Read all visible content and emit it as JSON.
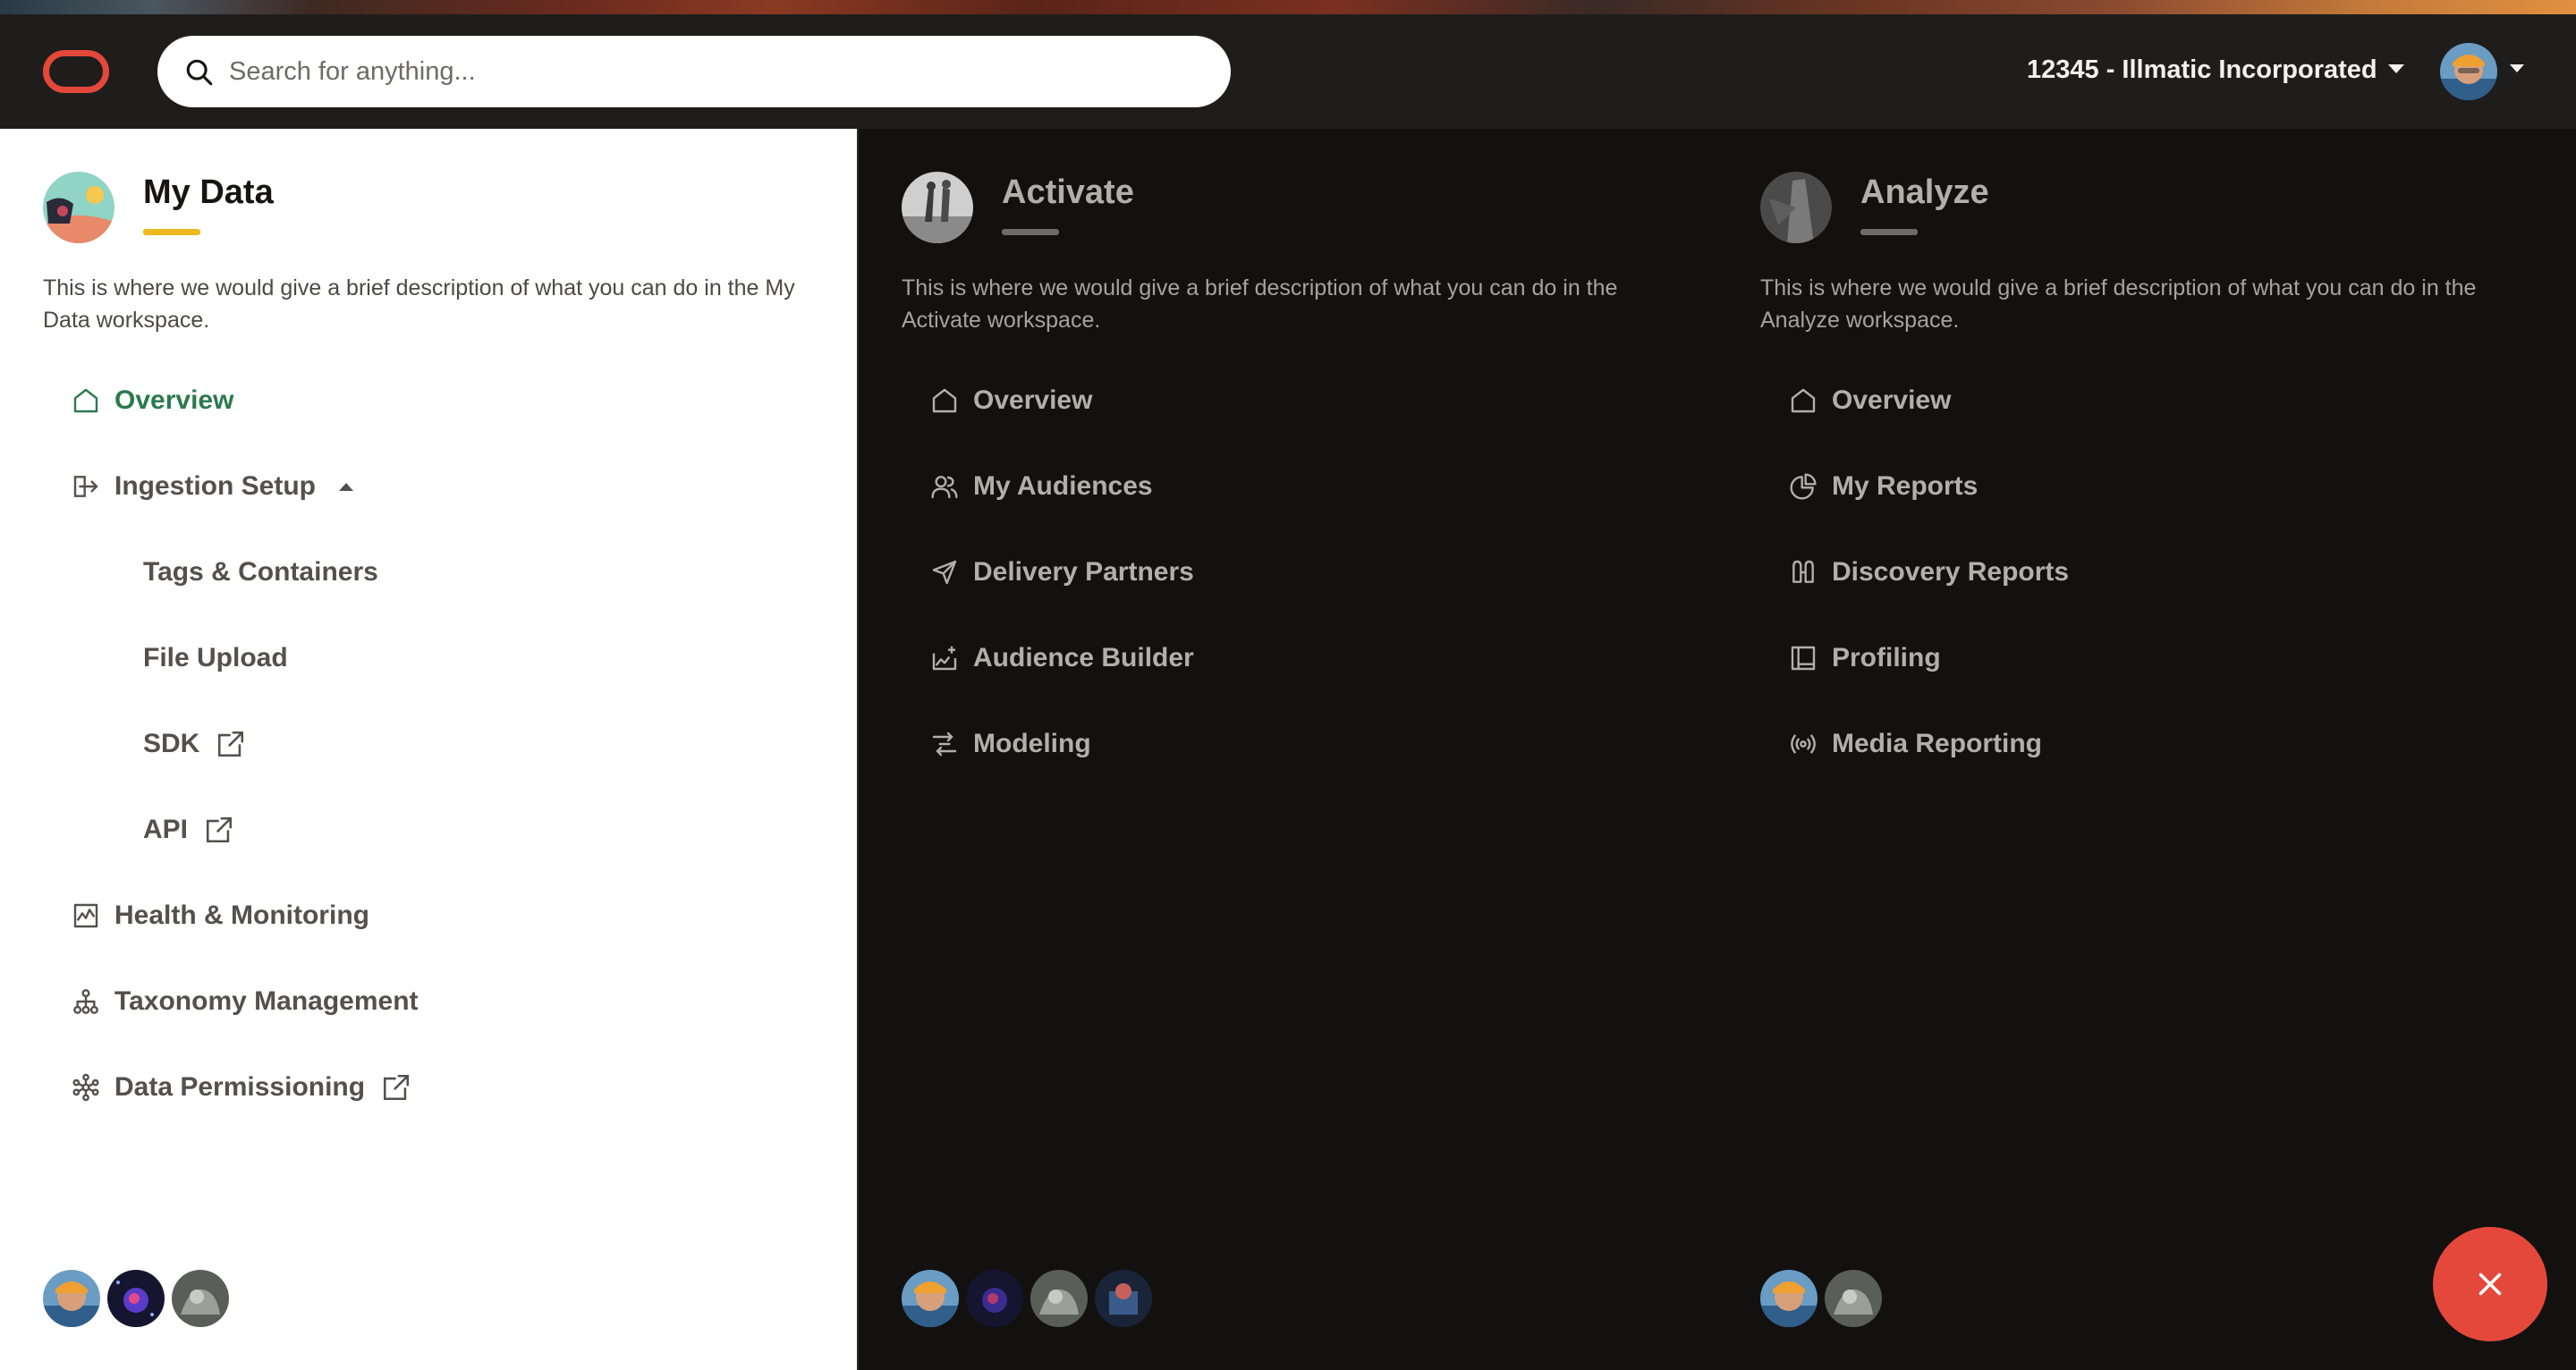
{
  "header": {
    "search_placeholder": "Search for anything...",
    "org_name": "12345 - Illmatic Incorporated"
  },
  "colors": {
    "accent_red": "#e4483b",
    "active_green": "#2b7a4e",
    "underline_yellow": "#f0b81f",
    "dark_bg": "#121110",
    "header_bg": "#1e1d1c"
  },
  "workspaces": {
    "my_data": {
      "title": "My Data",
      "description": "This is where we would give a brief description of what you can do in the My Data workspace.",
      "items": [
        {
          "label": "Overview",
          "icon": "home-icon"
        },
        {
          "label": "Ingestion Setup",
          "icon": "ingestion-icon"
        },
        {
          "label": "Tags & Containers"
        },
        {
          "label": "File Upload"
        },
        {
          "label": "SDK",
          "icon": "external-link-icon"
        },
        {
          "label": "API",
          "icon": "external-link-icon"
        },
        {
          "label": "Health & Monitoring",
          "icon": "chart-line-icon"
        },
        {
          "label": "Taxonomy Management",
          "icon": "hierarchy-icon"
        },
        {
          "label": "Data Permissioning",
          "icon": "network-icon"
        }
      ]
    },
    "activate": {
      "title": "Activate",
      "description": "This is where we would give a brief description of what you can do in the Activate workspace.",
      "items": [
        {
          "label": "Overview",
          "icon": "home-icon"
        },
        {
          "label": "My Audiences",
          "icon": "people-icon"
        },
        {
          "label": "Delivery Partners",
          "icon": "send-icon"
        },
        {
          "label": "Audience Builder",
          "icon": "builder-icon"
        },
        {
          "label": "Modeling",
          "icon": "modeling-icon"
        }
      ]
    },
    "analyze": {
      "title": "Analyze",
      "description": "This is where we would give a brief description of what you can do in the Analyze workspace.",
      "items": [
        {
          "label": "Overview",
          "icon": "home-icon"
        },
        {
          "label": "My Reports",
          "icon": "pie-chart-icon"
        },
        {
          "label": "Discovery Reports",
          "icon": "binoculars-icon"
        },
        {
          "label": "Profiling",
          "icon": "book-icon"
        },
        {
          "label": "Media Reporting",
          "icon": "broadcast-icon"
        }
      ]
    }
  }
}
